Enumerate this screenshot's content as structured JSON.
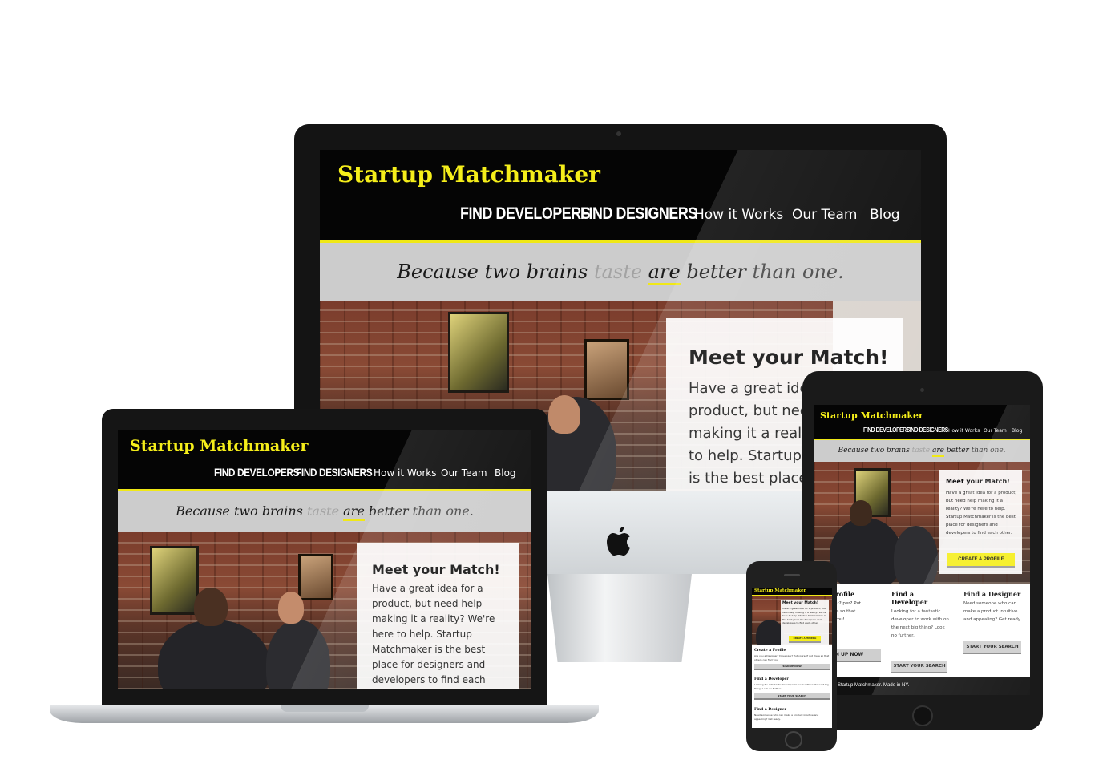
{
  "site": {
    "logo": "Startup Matchmaker",
    "nav": {
      "find_developers": "FIND DEVELOPERS",
      "find_designers": "FIND DESIGNERS",
      "how_it_works": "How it Works",
      "our_team": "Our Team",
      "blog": "Blog"
    },
    "tagline": {
      "part1": "Because two brains ",
      "taste": "taste",
      "are": "are",
      "better": " better ",
      "than_one": "than one."
    },
    "hero": {
      "heading": "Meet your Match!",
      "body": "Have a great idea for a product, but need help making it a reality? We're here to help. Startup Matchmaker is the best place for designers and developers to find each other.",
      "cta": "CREATE A PROFILE"
    },
    "sections": {
      "profile": {
        "title": "Create a Profile",
        "body": "Are you a Designer? Developer? Put yourself out there so that others can find you!",
        "button": "SIGN UP NOW"
      },
      "developer": {
        "title": "Find a Developer",
        "body": "Looking for a fantastic developer to work with on the next big thing? Look no further.",
        "button": "START YOUR SEARCH"
      },
      "designer": {
        "title": "Find a Designer",
        "body": "Need someone who can make a product intuitive and appealing? Get ready.",
        "button": "START YOUR SEARCH"
      }
    },
    "footer": "Startup Matchmaker. Made in NY."
  },
  "imac_card_partial": {
    "line1": "Have a great idea f",
    "line2": "product, but need",
    "line3": "making it a reality",
    "line4": "to help. Startup M",
    "line5": "is the best place fo"
  },
  "ipad_profile_partial": {
    "title": "te a Profile",
    "body": "a Designer? per? Put yourself re so that others d you!",
    "button": "GN UP NOW"
  },
  "colors": {
    "accent": "#f0e816",
    "header_bg": "#050505",
    "tagline_bg": "#cccccc"
  }
}
